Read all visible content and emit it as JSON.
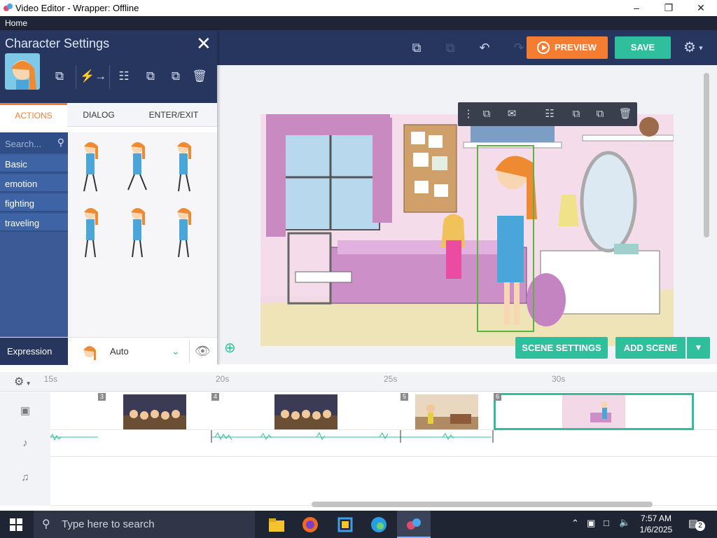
{
  "window": {
    "title": "Video Editor - Wrapper: Offline",
    "menu_home": "Home"
  },
  "toolbar": {
    "preview_label": "PREVIEW",
    "save_label": "SAVE"
  },
  "character_panel": {
    "title": "Character Settings",
    "tabs": [
      "ACTIONS",
      "DIALOG",
      "ENTER/EXIT"
    ],
    "search_placeholder": "Search...",
    "categories": [
      "Basic",
      "emotion",
      "fighting",
      "traveling"
    ],
    "expression_label": "Expression",
    "expression_value": "Auto"
  },
  "stage": {
    "scene_settings_label": "SCENE SETTINGS",
    "add_scene_label": "ADD SCENE"
  },
  "timeline": {
    "tick_labels": [
      "15s",
      "20s",
      "25s",
      "30s"
    ],
    "scenes": [
      {
        "number": "3"
      },
      {
        "number": "4"
      },
      {
        "number": "5"
      },
      {
        "number": "6"
      }
    ]
  },
  "taskbar": {
    "search_placeholder": "Type here to search",
    "time": "7:57 AM",
    "date": "1/6/2025",
    "notification_count": "2"
  },
  "colors": {
    "accent_orange": "#f47d31",
    "accent_teal": "#2fbf9d",
    "navy": "#27365f"
  }
}
